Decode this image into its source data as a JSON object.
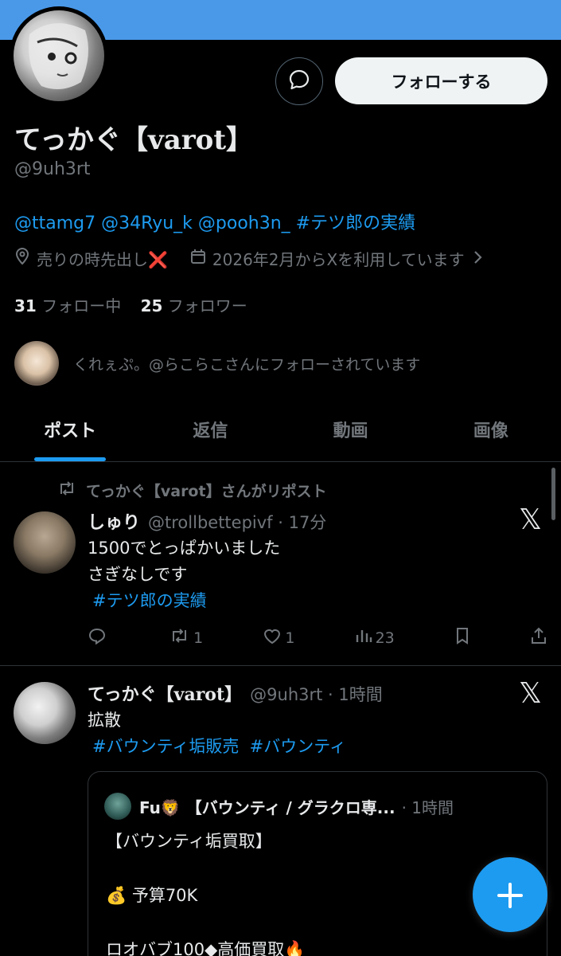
{
  "profile": {
    "name": "てっかぐ【varot】",
    "handle": "@9uh3rt",
    "follow_label": "フォローする",
    "bio": "@ttamg7 @34Ryu_k @pooh3n_ #テツ郎の実績",
    "location": "売りの時先出し❌",
    "joined": "2026年2月からXを利用しています",
    "following_count": "31",
    "following_label": " フォロー中",
    "followers_count": "25",
    "followers_label": " フォロワー",
    "followed_by": "くれぇぷ。@らこらこさんにフォローされています"
  },
  "tabs": [
    {
      "label": "ポスト",
      "active": true
    },
    {
      "label": "返信",
      "active": false
    },
    {
      "label": "動画",
      "active": false
    },
    {
      "label": "画像",
      "active": false
    }
  ],
  "posts": [
    {
      "repost_label": "てっかぐ【varot】さんがリポスト",
      "name": "しゅり",
      "handle_time": "@trollbettepivf · 17分",
      "text_line1": "1500でとっぱかいました",
      "text_line2": "さぎなしです",
      "hashtag": "#テツ郎の実績",
      "replies": "",
      "reposts": "1",
      "likes": "1",
      "views": "23"
    },
    {
      "name": "てっかぐ【varot】",
      "handle_time": "@9uh3rt · 1時間",
      "text_line1": "拡散",
      "hashtags": "#バウンティ垢販売  #バウンティ",
      "quote": {
        "name": "Fu🦁 【バウンティ / グラクロ専...",
        "time": "· 1時間",
        "line1": "【バウンティ垢買取】",
        "line2": "💰 予算70K",
        "line3": "ロオバブ100◆高価買取🔥"
      }
    }
  ],
  "colors": {
    "accent": "#1d9bf0",
    "banner": "#4a99e9",
    "background": "#000000",
    "muted": "#71767b"
  },
  "icons": {
    "message": "message-icon",
    "location": "location-icon",
    "calendar": "calendar-icon",
    "fab": "plus-icon"
  }
}
